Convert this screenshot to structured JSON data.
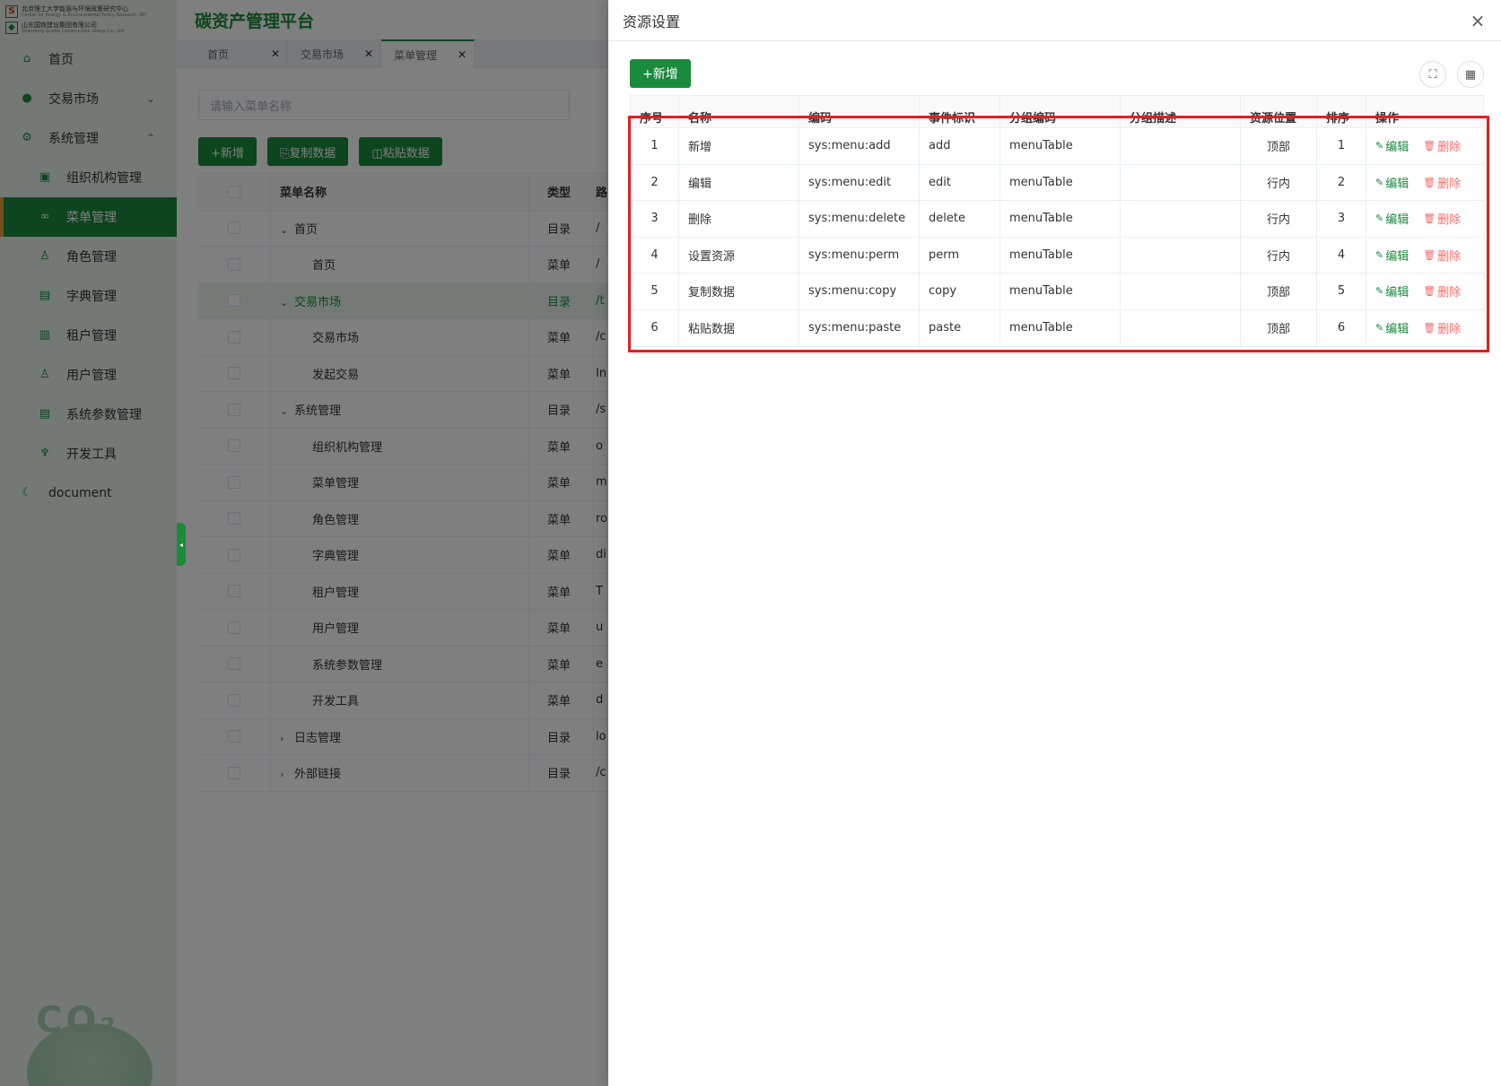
{
  "sidebar": {
    "logo_line1": "北京理工大学能源与环境政策研究中心",
    "logo_line1_sub": "Center for Energy & Environmental Policy Research, BIT",
    "logo_line2": "山东国铁建设集团有限公司",
    "logo_line2_sub": "Shandong Guotie Construction Group Co., Ltd",
    "items": [
      {
        "label": "首页",
        "icon": "home-icon",
        "level": 0
      },
      {
        "label": "交易市场",
        "icon": "money-bag-icon",
        "level": 0,
        "chevron": "⌄"
      },
      {
        "label": "系统管理",
        "icon": "gear-icon",
        "level": 0,
        "chevron": "⌃"
      },
      {
        "label": "组织机构管理",
        "icon": "org-icon",
        "level": 1
      },
      {
        "label": "菜单管理",
        "icon": "bike-icon",
        "level": 1,
        "active": true
      },
      {
        "label": "角色管理",
        "icon": "user-icon",
        "level": 1
      },
      {
        "label": "字典管理",
        "icon": "book-icon",
        "level": 1
      },
      {
        "label": "租户管理",
        "icon": "tenant-icon",
        "level": 1
      },
      {
        "label": "用户管理",
        "icon": "user-icon",
        "level": 1
      },
      {
        "label": "系统参数管理",
        "icon": "book-icon",
        "level": 1
      },
      {
        "label": "开发工具",
        "icon": "trophy-icon",
        "level": 1
      },
      {
        "label": "document",
        "icon": "moon-icon",
        "level": 0
      }
    ],
    "co2_text": "CO₂"
  },
  "header": {
    "title": "碳资产管理平台"
  },
  "tabs": [
    {
      "label": "首页"
    },
    {
      "label": "交易市场"
    },
    {
      "label": "菜单管理",
      "active": true
    }
  ],
  "menu_page": {
    "search_placeholder": "请输入菜单名称",
    "buttons": {
      "add": "+新增",
      "copy": "⎘复制数据",
      "paste": "◫粘贴数据"
    },
    "columns": {
      "name": "菜单名称",
      "type": "类型",
      "path": "路"
    },
    "rows": [
      {
        "name": "首页",
        "type": "目录",
        "path": "/",
        "level": 1,
        "arrow": "⌄"
      },
      {
        "name": "首页",
        "type": "菜单",
        "path": "/",
        "level": 2,
        "arrow": ""
      },
      {
        "name": "交易市场",
        "type": "目录",
        "path": "/t",
        "level": 1,
        "arrow": "⌄",
        "highlight": true
      },
      {
        "name": "交易市场",
        "type": "菜单",
        "path": "/c",
        "level": 2,
        "arrow": ""
      },
      {
        "name": "发起交易",
        "type": "菜单",
        "path": "In",
        "level": 2,
        "arrow": ""
      },
      {
        "name": "系统管理",
        "type": "目录",
        "path": "/s",
        "level": 1,
        "arrow": "⌄"
      },
      {
        "name": "组织机构管理",
        "type": "菜单",
        "path": "o",
        "level": 2,
        "arrow": ""
      },
      {
        "name": "菜单管理",
        "type": "菜单",
        "path": "m",
        "level": 2,
        "arrow": ""
      },
      {
        "name": "角色管理",
        "type": "菜单",
        "path": "ro",
        "level": 2,
        "arrow": ""
      },
      {
        "name": "字典管理",
        "type": "菜单",
        "path": "di",
        "level": 2,
        "arrow": ""
      },
      {
        "name": "租户管理",
        "type": "菜单",
        "path": "T",
        "level": 2,
        "arrow": ""
      },
      {
        "name": "用户管理",
        "type": "菜单",
        "path": "u",
        "level": 2,
        "arrow": ""
      },
      {
        "name": "系统参数管理",
        "type": "菜单",
        "path": "e",
        "level": 2,
        "arrow": ""
      },
      {
        "name": "开发工具",
        "type": "菜单",
        "path": "d",
        "level": 2,
        "arrow": ""
      },
      {
        "name": "日志管理",
        "type": "目录",
        "path": "lo",
        "level": 1,
        "arrow": "›"
      },
      {
        "name": "外部链接",
        "type": "目录",
        "path": "/c",
        "level": 1,
        "arrow": "›"
      }
    ]
  },
  "drawer": {
    "title": "资源设置",
    "close_icon": "×",
    "add_label": "+新增",
    "columns": [
      "序号",
      "名称",
      "编码",
      "事件标识",
      "分组编码",
      "分组描述",
      "资源位置",
      "排序",
      "操作"
    ],
    "rows": [
      {
        "no": "1",
        "name": "新增",
        "code": "sys:menu:add",
        "event": "add",
        "group_code": "menuTable",
        "group_desc": "",
        "position": "顶部",
        "sort": "1"
      },
      {
        "no": "2",
        "name": "编辑",
        "code": "sys:menu:edit",
        "event": "edit",
        "group_code": "menuTable",
        "group_desc": "",
        "position": "行内",
        "sort": "2"
      },
      {
        "no": "3",
        "name": "删除",
        "code": "sys:menu:delete",
        "event": "delete",
        "group_code": "menuTable",
        "group_desc": "",
        "position": "行内",
        "sort": "3"
      },
      {
        "no": "4",
        "name": "设置资源",
        "code": "sys:menu:perm",
        "event": "perm",
        "group_code": "menuTable",
        "group_desc": "",
        "position": "行内",
        "sort": "4"
      },
      {
        "no": "5",
        "name": "复制数据",
        "code": "sys:menu:copy",
        "event": "copy",
        "group_code": "menuTable",
        "group_desc": "",
        "position": "顶部",
        "sort": "5"
      },
      {
        "no": "6",
        "name": "粘贴数据",
        "code": "sys:menu:paste",
        "event": "paste",
        "group_code": "menuTable",
        "group_desc": "",
        "position": "顶部",
        "sort": "6"
      }
    ],
    "op_edit": "编辑",
    "op_delete": "删除"
  },
  "colors": {
    "accent": "#1a8a3c",
    "danger": "#f56c6c",
    "annotation": "#e02020"
  }
}
